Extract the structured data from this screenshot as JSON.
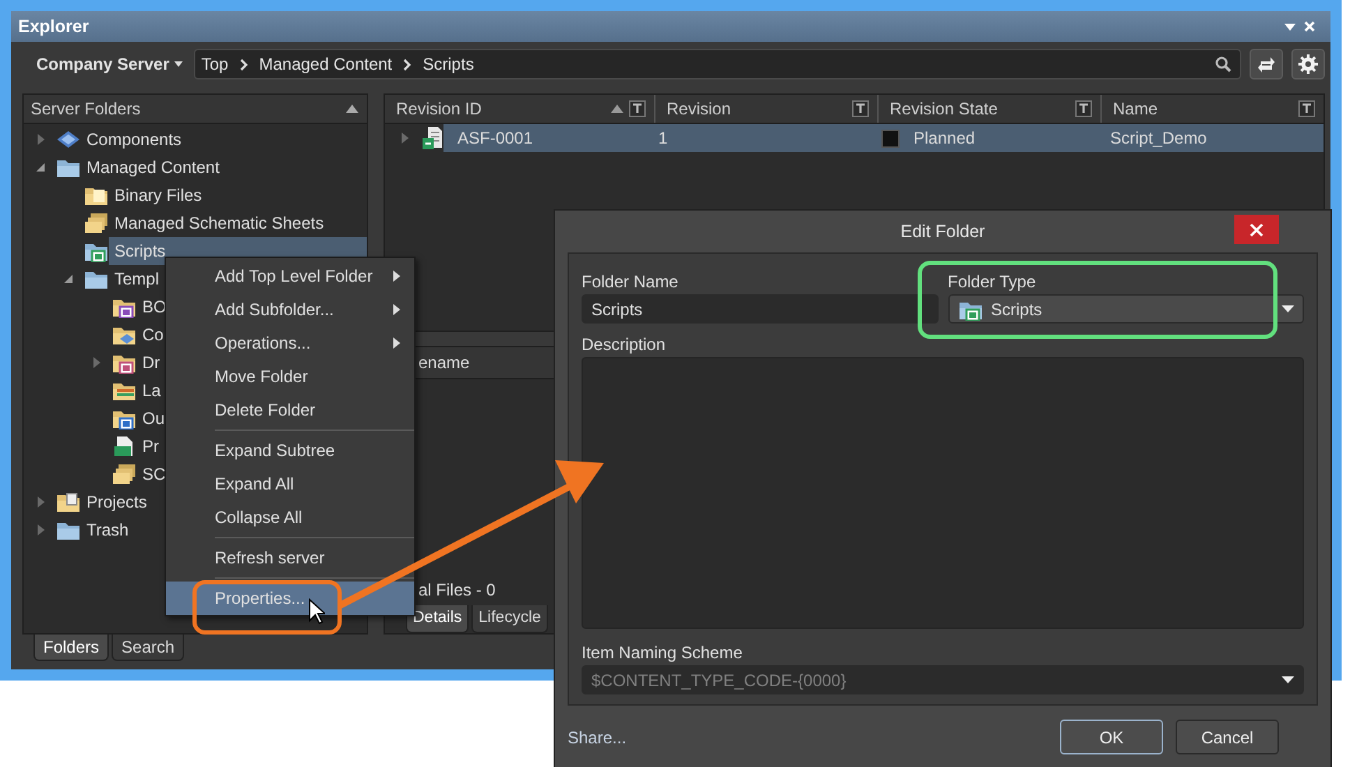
{
  "window": {
    "title": "Explorer"
  },
  "toolbar": {
    "server": "Company Server",
    "breadcrumb": [
      "Top",
      "Managed Content",
      "Scripts"
    ]
  },
  "folders_panel": {
    "title": "Server Folders",
    "tree": [
      {
        "label": "Components",
        "kind": "components",
        "expanded": false,
        "selected": false
      },
      {
        "label": "Managed Content",
        "kind": "folder",
        "expanded": true,
        "selected": false,
        "children": [
          {
            "label": "Binary Files",
            "kind": "binary",
            "selected": false
          },
          {
            "label": "Managed Schematic Sheets",
            "kind": "sheets",
            "selected": false
          },
          {
            "label": "Scripts",
            "kind": "scripts",
            "selected": true
          },
          {
            "label": "Templ",
            "kind": "folder",
            "expanded": true,
            "selected": false,
            "children": [
              {
                "label": "BO",
                "kind": "bom",
                "selected": false
              },
              {
                "label": "Co",
                "kind": "component_templates",
                "selected": false
              },
              {
                "label": "Dr",
                "kind": "drawing",
                "expanded": false,
                "selected": false
              },
              {
                "label": "La",
                "kind": "layers",
                "selected": false
              },
              {
                "label": "Ou",
                "kind": "output",
                "selected": false
              },
              {
                "label": "Pr",
                "kind": "project_templates",
                "selected": false
              },
              {
                "label": "SC",
                "kind": "sheets",
                "selected": false
              }
            ]
          }
        ]
      },
      {
        "label": "Projects",
        "kind": "projects",
        "expanded": false,
        "selected": false
      },
      {
        "label": "Trash",
        "kind": "folder",
        "expanded": false,
        "selected": false
      }
    ]
  },
  "bottom_tabs": [
    {
      "label": "Folders",
      "selected": true
    },
    {
      "label": "Search",
      "selected": false
    }
  ],
  "revisions": {
    "columns": [
      {
        "label": "Revision ID",
        "sorted": true
      },
      {
        "label": "Revision",
        "sorted": false
      },
      {
        "label": "Revision State",
        "sorted": false
      },
      {
        "label": "Name",
        "sorted": false
      }
    ],
    "rows": [
      {
        "expanded": false,
        "selected": true,
        "color": "#111111",
        "cells": [
          "ASF-0001",
          "1",
          "Planned",
          "Script_Demo"
        ]
      }
    ]
  },
  "details_pane": {
    "column_1": "ename",
    "summary": "al Files - 0",
    "tabs": [
      {
        "label": "Details",
        "selected": true
      },
      {
        "label": "Lifecycle",
        "selected": false
      }
    ]
  },
  "context_menu": {
    "items": [
      {
        "kind": "item",
        "label": "Add Top Level Folder",
        "submenu": true,
        "selected": false
      },
      {
        "kind": "item",
        "label": "Add Subfolder...",
        "submenu": true,
        "selected": false
      },
      {
        "kind": "item",
        "label": "Operations...",
        "submenu": true,
        "selected": false
      },
      {
        "kind": "item",
        "label": "Move Folder",
        "submenu": false,
        "selected": false
      },
      {
        "kind": "item",
        "label": "Delete Folder",
        "submenu": false,
        "selected": false
      },
      {
        "kind": "separator"
      },
      {
        "kind": "item",
        "label": "Expand Subtree",
        "submenu": false,
        "selected": false
      },
      {
        "kind": "item",
        "label": "Expand All",
        "submenu": false,
        "selected": false
      },
      {
        "kind": "item",
        "label": "Collapse All",
        "submenu": false,
        "selected": false
      },
      {
        "kind": "separator"
      },
      {
        "kind": "item",
        "label": "Refresh server",
        "submenu": false,
        "selected": false
      },
      {
        "kind": "separator"
      },
      {
        "kind": "item",
        "label": "Properties...",
        "submenu": false,
        "selected": true
      }
    ]
  },
  "dialog": {
    "title": "Edit Folder",
    "folder_name_label": "Folder Name",
    "folder_name": "Scripts",
    "folder_type_label": "Folder Type",
    "folder_type": "Scripts",
    "description_label": "Description",
    "naming_label": "Item Naming Scheme",
    "naming_scheme": "$CONTENT_TYPE_CODE-{0000}",
    "naming_disabled": true,
    "share": "Share...",
    "buttons": [
      {
        "label": "OK",
        "default": true
      },
      {
        "label": "Cancel",
        "default": false
      }
    ]
  }
}
